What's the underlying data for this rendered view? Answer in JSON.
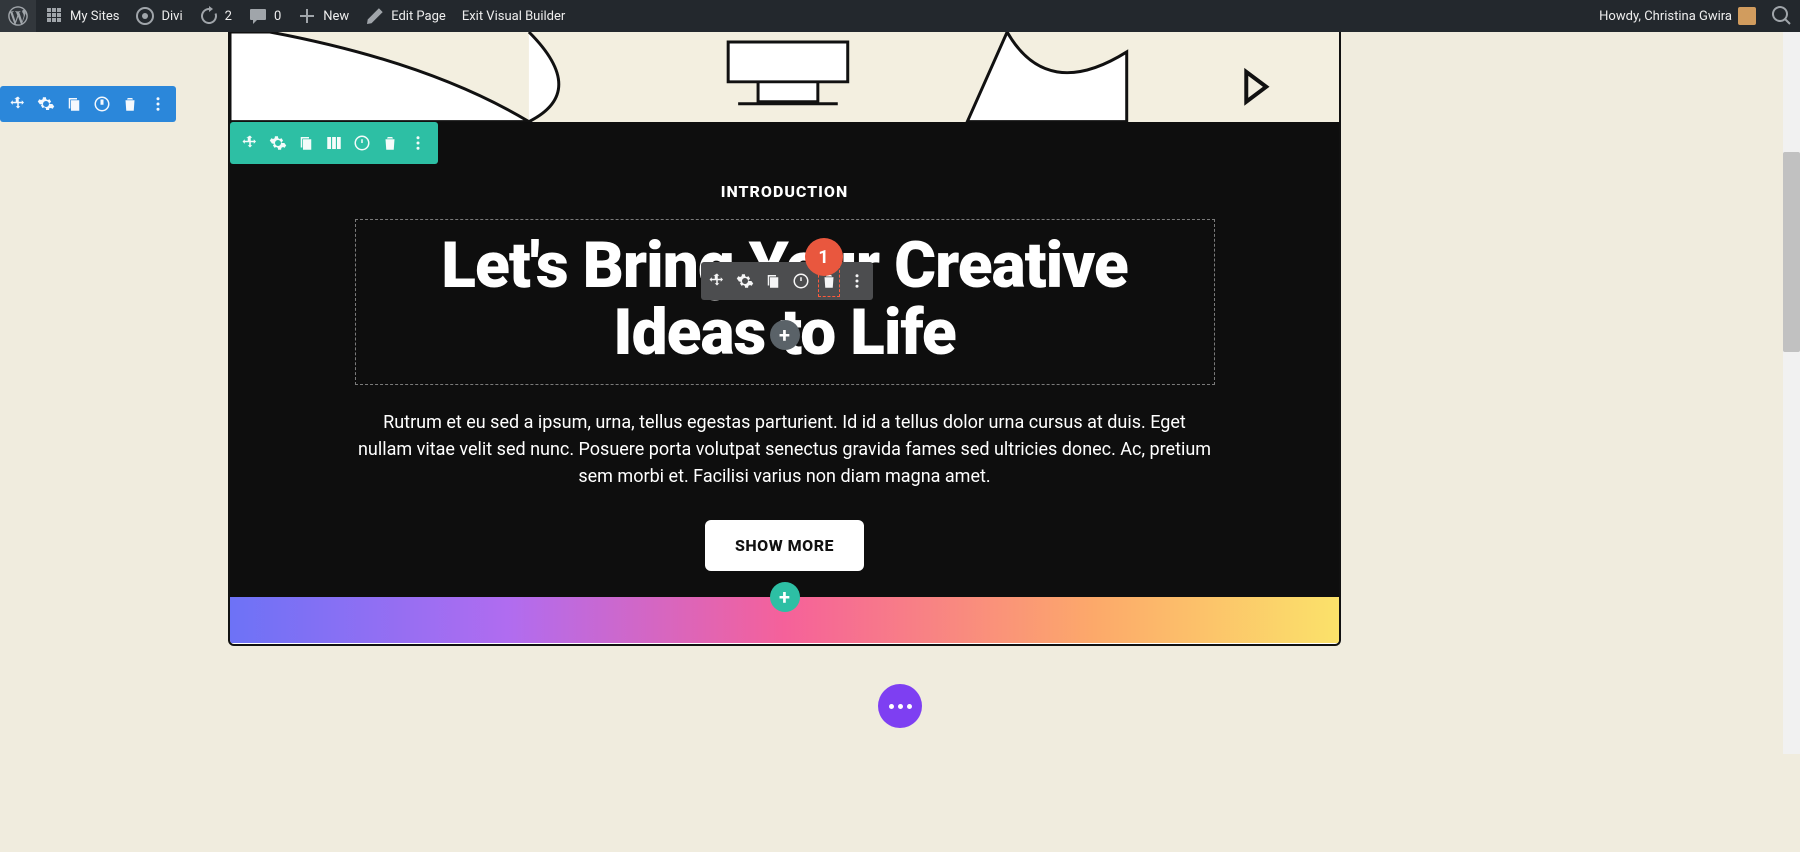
{
  "adminbar": {
    "mysites": "My Sites",
    "divi": "Divi",
    "updates": "2",
    "comments": "0",
    "new": "New",
    "edit": "Edit Page",
    "exit": "Exit Visual Builder",
    "howdy": "Howdy, Christina Gwira"
  },
  "intro": {
    "subheading": "INTRODUCTION",
    "heading": "Let's Bring Your Creative Ideas to Life",
    "body": "Rutrum et eu sed a ipsum, urna, tellus egestas parturient. Id id a tellus dolor urna cursus at duis. Eget nullam vitae velit sed nunc. Posuere porta volutpat senectus gravida fames sed ultricies donec. Ac, pretium sem morbi et. Facilisi varius non diam magna amet.",
    "cta": "SHOW MORE"
  },
  "badge": "1",
  "icons": {
    "plus": "+",
    "move": "move",
    "gear": "settings",
    "dup": "duplicate",
    "save": "save",
    "trash": "delete",
    "dots": "more",
    "cols": "columns"
  }
}
